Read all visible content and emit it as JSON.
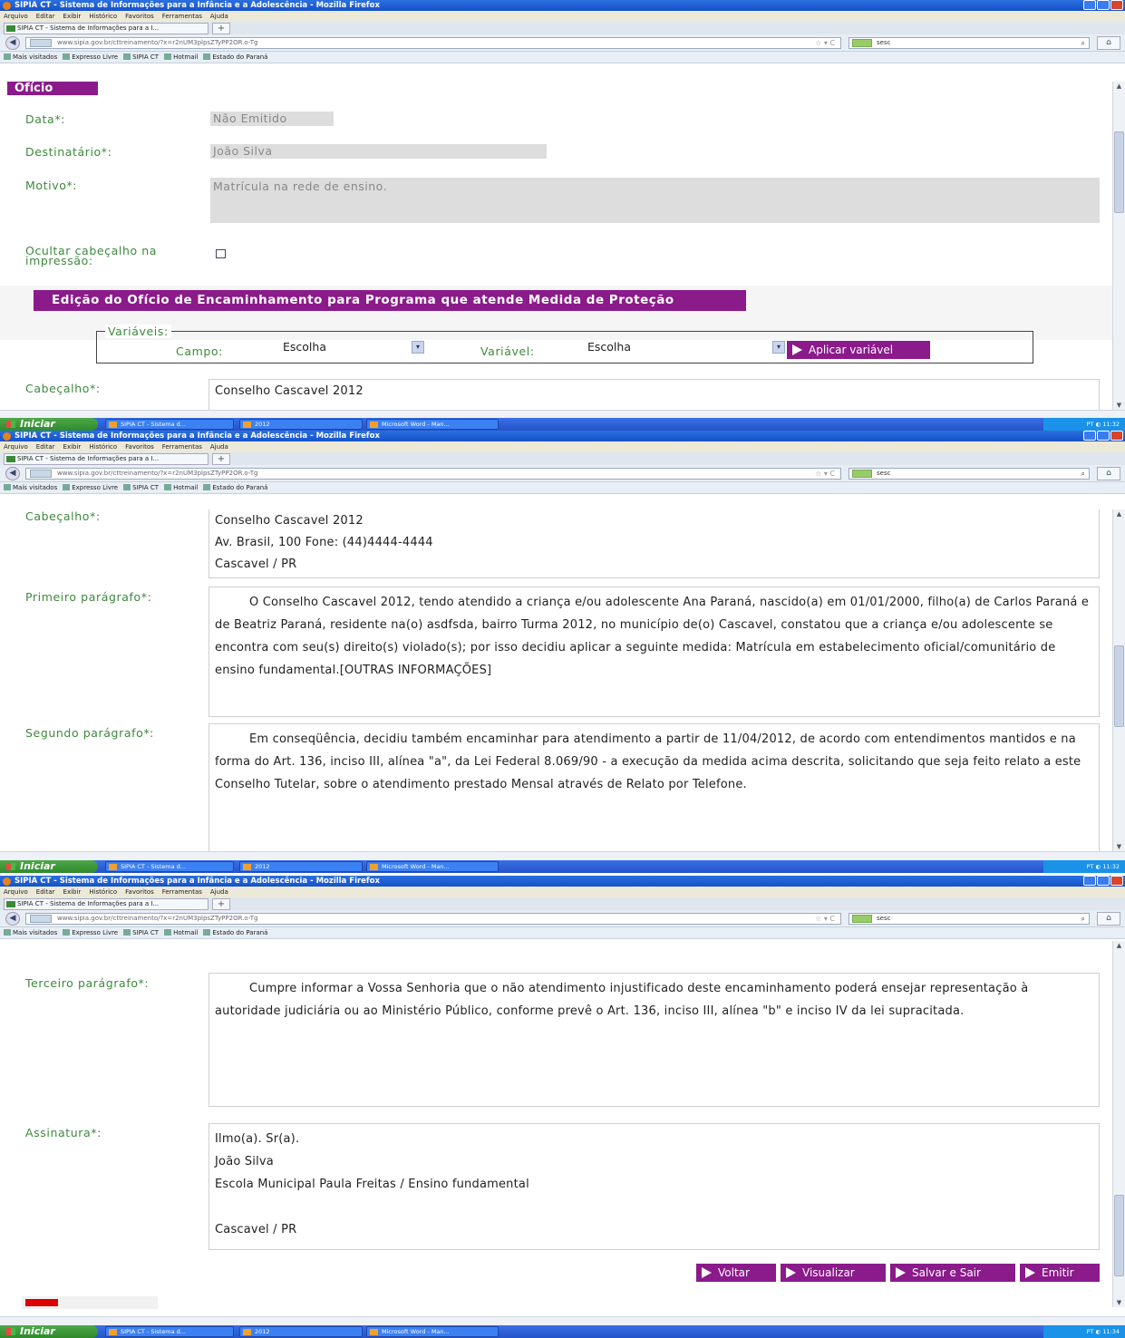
{
  "browser": {
    "window_title": "SIPIA CT - Sistema de Informações para a Infância e a Adolescência - Mozilla Firefox",
    "menu": [
      "Arquivo",
      "Editar",
      "Exibir",
      "Histórico",
      "Favoritos",
      "Ferramentas",
      "Ajuda"
    ],
    "tab_label": "SIPIA CT - Sistema de Informações para a I...",
    "new_tab": "+",
    "url": "www.sipia.gov.br/cttreinamento/?x=r2nUM3plpsZTyPP2OR.o-Tg",
    "search_value": "sesc",
    "bookmarks": [
      "Mais visitados",
      "Expresso Livre",
      "SIPIA CT",
      "Hotmail",
      "Estado do Paraná"
    ]
  },
  "taskbar": {
    "start_label": "Iniciar",
    "tasks": [
      "SIPIA CT - Sistema d...",
      "2012",
      "Microsoft Word - Man..."
    ],
    "lang": "PT",
    "time_1": "11:32",
    "time_2": "11:32",
    "time_3": "11:34"
  },
  "oficio": {
    "section_title": "Ofício",
    "data_label": "Data*:",
    "data_value": "Não Emitido",
    "destinatario_label": "Destinatário*:",
    "destinatario_value": "João Silva",
    "motivo_label": "Motivo*:",
    "motivo_value": "Matrícula na rede de ensino.",
    "ocultar_label": "Ocultar cabeçalho na impressão:"
  },
  "edicao": {
    "section_title": "Edição do Ofício de Encaminhamento para Programa que atende Medida de Proteção",
    "variaveis_legend": "Variáveis:",
    "campo_label": "Campo:",
    "campo_value": "Escolha",
    "variavel_label": "Variável:",
    "variavel_value": "Escolha",
    "aplicar_button": "Aplicar variável"
  },
  "cabecalho": {
    "label": "Cabeçalho*:",
    "line1": "Conselho Cascavel 2012",
    "line2": "Av. Brasil, 100  Fone: (44)4444-4444",
    "line3": "Cascavel / PR"
  },
  "primeiro": {
    "label": "Primeiro parágrafo*:",
    "text": "O Conselho Cascavel 2012, tendo atendido a criança e/ou adolescente Ana Paraná, nascido(a) em  01/01/2000, filho(a) de Carlos Paraná e de Beatriz Paraná,  residente na(o) asdfsda, bairro Turma 2012, no município de(o) Cascavel, constatou que a criança e/ou adolescente se encontra com seu(s) direito(s) violado(s);  por isso decidiu aplicar a seguinte medida: Matrícula em estabelecimento oficial/comunitário de ensino fundamental.[OUTRAS INFORMAÇÕES]"
  },
  "segundo": {
    "label": "Segundo parágrafo*:",
    "text": "Em conseqüência, decidiu também encaminhar para atendimento a partir de 11/04/2012,  de acordo com entendimentos mantidos e na forma do Art. 136, inciso III, alínea \"a\", da Lei Federal 8.069/90 - a execução da medida acima descrita, solicitando que seja feito relato a este Conselho Tutelar, sobre o atendimento prestado Mensal através de Relato por Telefone."
  },
  "terceiro": {
    "label": "Terceiro parágrafo*:",
    "text": "Cumpre informar a Vossa Senhoria  que o não atendimento injustificado deste encaminhamento poderá ensejar representação à autoridade judiciária ou ao Ministério Público,  conforme prevê o Art. 136, inciso III, alínea \"b\" e inciso IV da lei supracitada."
  },
  "assinatura": {
    "label": "Assinatura*:",
    "line1": "Ilmo(a).  Sr(a).",
    "line2": "João Silva",
    "line3": "Escola Municipal Paula Freitas / Ensino fundamental",
    "line4": "Cascavel / PR"
  },
  "actions": {
    "voltar": "Voltar",
    "visualizar": "Visualizar",
    "salvar": "Salvar e Sair",
    "emitir": "Emitir"
  }
}
